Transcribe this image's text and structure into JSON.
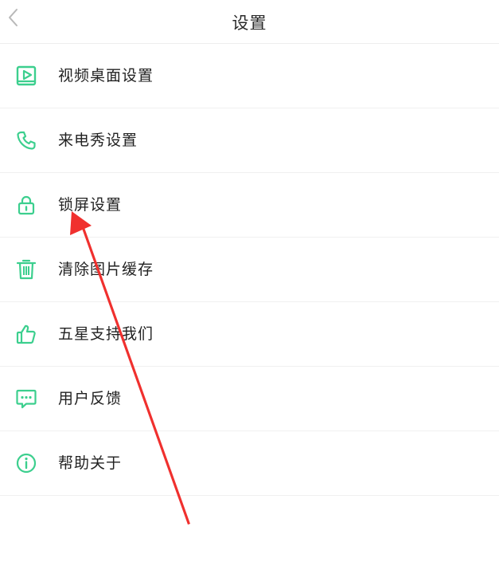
{
  "header": {
    "title": "设置",
    "back_icon": "chevron-left-icon"
  },
  "menu": {
    "items": [
      {
        "label": "视频桌面设置",
        "icon": "video-screen-icon"
      },
      {
        "label": "来电秀设置",
        "icon": "phone-icon"
      },
      {
        "label": "锁屏设置",
        "icon": "lock-icon"
      },
      {
        "label": "清除图片缓存",
        "icon": "trash-icon"
      },
      {
        "label": "五星支持我们",
        "icon": "thumbs-up-icon"
      },
      {
        "label": "用户反馈",
        "icon": "chat-bubble-icon"
      },
      {
        "label": "帮助关于",
        "icon": "info-icon"
      }
    ]
  },
  "colors": {
    "accent": "#3ccf8e",
    "annotation_arrow": "#f0302e",
    "text": "#222222",
    "divider": "#f0f0f0"
  }
}
